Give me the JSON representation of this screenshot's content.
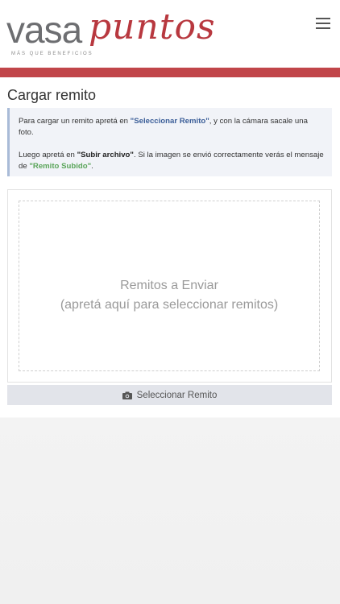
{
  "header": {
    "logo_part1": "vasa",
    "logo_part2": "puntos",
    "logo_tagline": "más que beneficios",
    "menu_icon": "hamburger-icon"
  },
  "colors": {
    "brand_red": "#c1454a",
    "link_blue": "#3b5e98",
    "success_green": "#5aa55a"
  },
  "page": {
    "title": "Cargar remito"
  },
  "info": {
    "line1_pre": "Para cargar un remito apretá en ",
    "line1_link": "\"Seleccionar Remito\"",
    "line1_post": ", y con la cámara sacale una foto.",
    "line2_pre": "Luego apretá en ",
    "line2_bold": "\"Subir archivo\"",
    "line2_mid": ". Si la imagen se envió correctamente verás el mensaje de ",
    "line2_success": "\"Remito Subido\"",
    "line2_end": "."
  },
  "dropzone": {
    "line1": "Remitos a Enviar",
    "line2": "(apretá aquí para seleccionar remitos)"
  },
  "select_button": {
    "label": "Seleccionar Remito",
    "icon": "camera-icon"
  }
}
